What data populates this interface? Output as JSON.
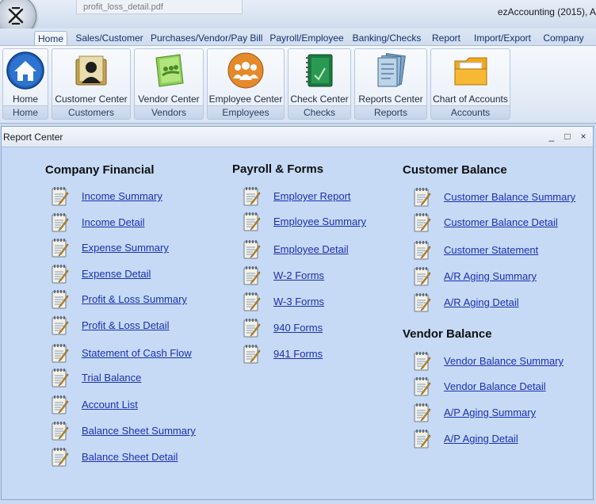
{
  "app": {
    "title": "ezAccounting (2015), A",
    "doc_tab": "profit_loss_detail.pdf"
  },
  "ribbon_tabs": [
    "Home",
    "Sales/Customer",
    "Purchases/Vendor/Pay Bill",
    "Payroll/Employee",
    "Banking/Checks",
    "Report",
    "Import/Export",
    "Company"
  ],
  "ribbon_groups": [
    {
      "button": "Home",
      "group": "Home",
      "icon": "house-icon"
    },
    {
      "button": "Customer Center",
      "group": "Customers",
      "icon": "customer-folder-icon"
    },
    {
      "button": "Vendor Center",
      "group": "Vendors",
      "icon": "vendor-book-icon"
    },
    {
      "button": "Employee Center",
      "group": "Employees",
      "icon": "employees-icon"
    },
    {
      "button": "Check Center",
      "group": "Checks",
      "icon": "checkbook-icon"
    },
    {
      "button": "Reports Center",
      "group": "Reports",
      "icon": "reports-binder-icon"
    },
    {
      "button": "Chart of Accounts",
      "group": "Accounts",
      "icon": "accounts-folder-icon"
    }
  ],
  "window": {
    "title": "Report Center",
    "controls": [
      "_",
      "□",
      "×"
    ]
  },
  "sections": {
    "company_financial": {
      "title": "Company Financial",
      "items": [
        "Income Summary",
        "Income Detail",
        "Expense Summary",
        "Expense Detail",
        "Profit & Loss Summary",
        "Profit & Loss Detail",
        "Statement of Cash Flow",
        "Trial Balance",
        "Account List",
        "Balance Sheet Summary",
        "Balance Sheet Detail"
      ]
    },
    "payroll_forms": {
      "title": "Payroll & Forms",
      "items": [
        "Employer Report",
        "Employee Summary",
        "Employee Detail",
        "W-2 Forms",
        "W-3 Forms",
        "940 Forms",
        "941 Forms"
      ]
    },
    "customer_balance": {
      "title": "Customer Balance",
      "items": [
        "Customer Balance Summary",
        "Customer Balance Detail",
        "Customer Statement",
        "A/R Aging Summary",
        "A/R Aging Detail"
      ]
    },
    "vendor_balance": {
      "title": "Vendor Balance",
      "items": [
        "Vendor Balance Summary",
        "Vendor Balance Detail",
        "A/P Aging Summary",
        "A/P Aging Detail"
      ]
    }
  },
  "report_icon": "report-notepad-icon",
  "colors": {
    "link": "#1c2fb0",
    "panel_bg": "#c6daf6",
    "ribbon_bg": "#e6edf7"
  }
}
